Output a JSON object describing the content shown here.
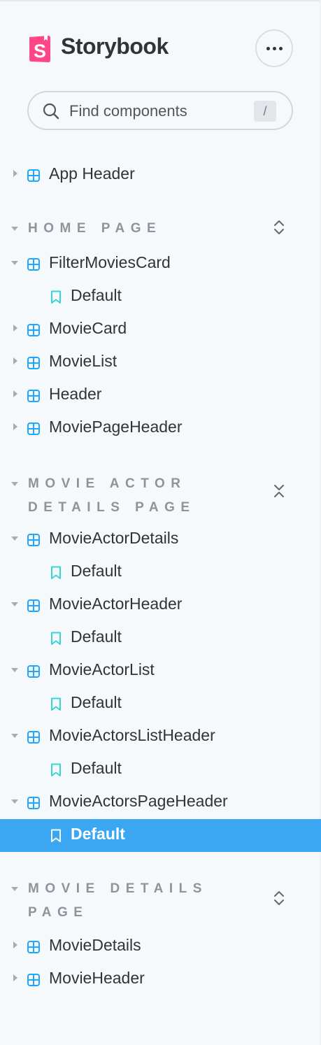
{
  "app": {
    "brand": "Storybook",
    "brand_color": "#ff4785",
    "selection_color": "#3ba6f2"
  },
  "search": {
    "placeholder": "Find components",
    "shortcut": "/"
  },
  "tree": {
    "app_header": "App Header",
    "groups": [
      {
        "title": "Home Page",
        "toggle_icon": "expand-all-icon",
        "items": [
          {
            "type": "component",
            "label": "FilterMoviesCard",
            "expanded": true
          },
          {
            "type": "story",
            "label": "Default"
          },
          {
            "type": "component",
            "label": "MovieCard",
            "expanded": false
          },
          {
            "type": "component",
            "label": "MovieList",
            "expanded": false
          },
          {
            "type": "component",
            "label": "Header",
            "expanded": false
          },
          {
            "type": "component",
            "label": "MoviePageHeader",
            "expanded": false
          }
        ]
      },
      {
        "title": "Movie Actor Details Page",
        "toggle_icon": "collapse-all-icon",
        "items": [
          {
            "type": "component",
            "label": "MovieActorDetails",
            "expanded": true
          },
          {
            "type": "story",
            "label": "Default"
          },
          {
            "type": "component",
            "label": "MovieActorHeader",
            "expanded": true
          },
          {
            "type": "story",
            "label": "Default"
          },
          {
            "type": "component",
            "label": "MovieActorList",
            "expanded": true
          },
          {
            "type": "story",
            "label": "Default"
          },
          {
            "type": "component",
            "label": "MovieActorsListHeader",
            "expanded": true
          },
          {
            "type": "story",
            "label": "Default"
          },
          {
            "type": "component",
            "label": "MovieActorsPageHeader",
            "expanded": true
          },
          {
            "type": "story",
            "label": "Default",
            "selected": true
          }
        ]
      },
      {
        "title": "Movie Details Page",
        "toggle_icon": "expand-all-icon",
        "items": [
          {
            "type": "component",
            "label": "MovieDetails",
            "expanded": false
          },
          {
            "type": "component",
            "label": "MovieHeader",
            "expanded": false
          }
        ]
      }
    ]
  }
}
